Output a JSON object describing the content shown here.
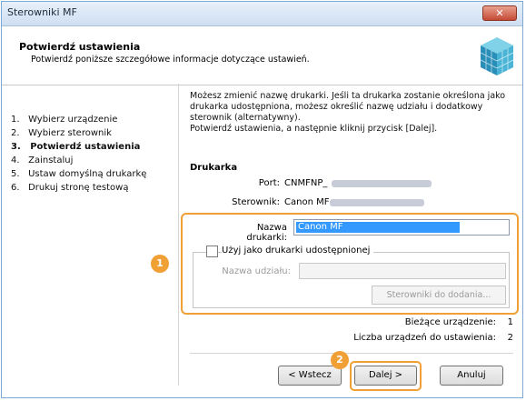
{
  "window": {
    "title": "Sterowniki MF",
    "close_label": "✕"
  },
  "header": {
    "title": "Potwierdź ustawienia",
    "subtitle": "Potwierdź poniższe szczegółowe informacje dotyczące ustawień."
  },
  "steps": [
    {
      "num": "1.",
      "label": "Wybierz urządzenie",
      "active": false
    },
    {
      "num": "2.",
      "label": "Wybierz sterownik",
      "active": false
    },
    {
      "num": "3.",
      "label": "Potwierdź ustawienia",
      "active": true
    },
    {
      "num": "4.",
      "label": "Zainstaluj",
      "active": false
    },
    {
      "num": "5.",
      "label": "Ustaw domyślną drukarkę",
      "active": false
    },
    {
      "num": "6.",
      "label": "Drukuj stronę testową",
      "active": false
    }
  ],
  "content": {
    "description": "Możesz zmienić nazwę drukarki. Jeśli ta drukarka zostanie określona jako drukarka udostępniona, możesz określić nazwę udziału i dodatkowy sterownik (alternatywny).\nPotwierdź ustawienia, a następnie kliknij przycisk [Dalej].",
    "section_title": "Drukarka",
    "port_label": "Port:",
    "port_value": "CNMFNP_",
    "driver_label": "Sterownik:",
    "driver_value": "Canon MF",
    "printer_name_label": "Nazwa drukarki:",
    "printer_name_value": "Canon MF",
    "share_checkbox_label": "Użyj jako drukarki udostępnionej",
    "share_name_label": "Nazwa udziału:",
    "share_name_value": "",
    "extra_drivers_label": "Sterowniki do dodania..."
  },
  "counts": {
    "current_label": "Bieżące urządzenie:",
    "current_value": "1",
    "total_label": "Liczba urządzeń do ustawienia:",
    "total_value": "2"
  },
  "buttons": {
    "back": "< Wstecz",
    "next": "Dalej >",
    "cancel": "Anuluj"
  },
  "badges": {
    "one": "1",
    "two": "2"
  },
  "colors": {
    "accent": "#f0a035",
    "selection": "#3399ff"
  }
}
